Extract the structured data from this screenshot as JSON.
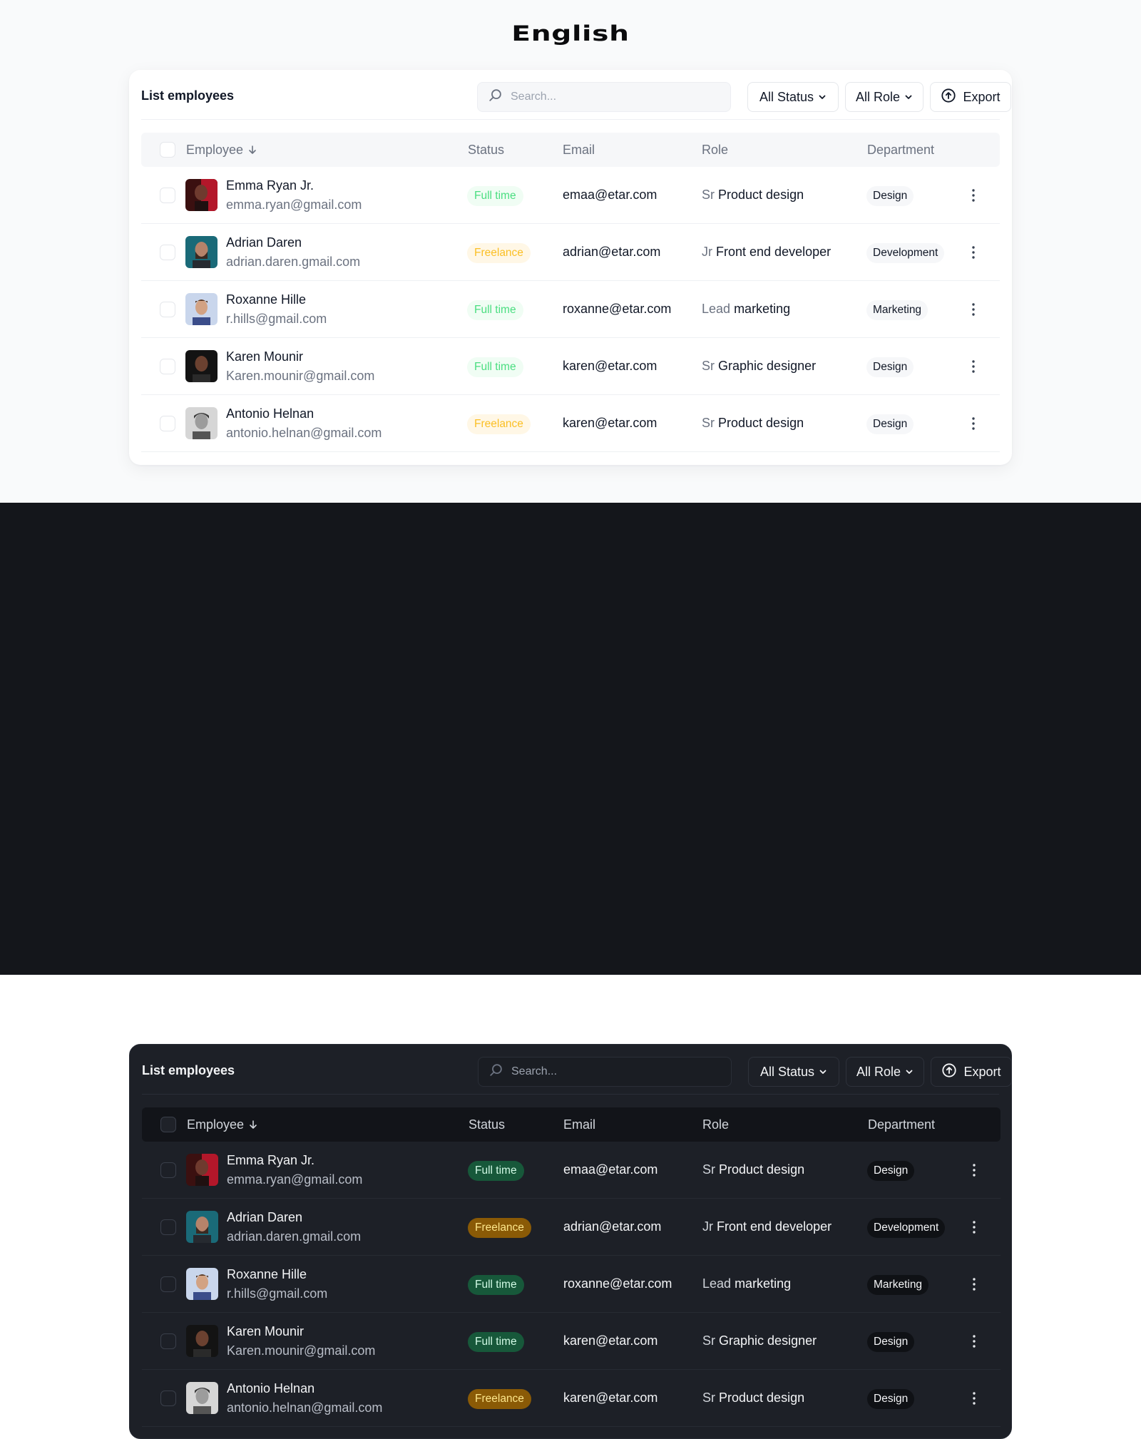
{
  "page": {
    "title": "English"
  },
  "card": {
    "title": "List employees",
    "search_placeholder": "Search...",
    "status_filter": "All Status",
    "role_filter": "All Role",
    "export_label": "Export"
  },
  "table": {
    "columns": {
      "employee": "Employee",
      "status": "Status",
      "email": "Email",
      "role": "Role",
      "department": "Department"
    },
    "rows": [
      {
        "name": "Emma Ryan Jr.",
        "personal_email": "emma.ryan@gmail.com",
        "status": "Full time",
        "status_type": "full",
        "email": "emaa@etar.com",
        "role_level": "Sr",
        "role_title": "Product design",
        "department": "Design",
        "avatar": "avatar-1"
      },
      {
        "name": "Adrian Daren",
        "personal_email": "adrian.daren.gmail.com",
        "status": "Freelance",
        "status_type": "free",
        "email": "adrian@etar.com",
        "role_level": "Jr",
        "role_title": "Front end developer",
        "department": "Development",
        "avatar": "avatar-2"
      },
      {
        "name": "Roxanne Hille",
        "personal_email": "r.hills@gmail.com",
        "status": "Full time",
        "status_type": "full",
        "email": "roxanne@etar.com",
        "role_level": "Lead",
        "role_title": "marketing",
        "department": "Marketing",
        "avatar": "avatar-3"
      },
      {
        "name": "Karen Mounir",
        "personal_email": "Karen.mounir@gmail.com",
        "status": "Full time",
        "status_type": "full",
        "email": "karen@etar.com",
        "role_level": "Sr",
        "role_title": "Graphic designer",
        "department": "Design",
        "avatar": "avatar-4"
      },
      {
        "name": "Antonio Helnan",
        "personal_email": "antonio.helnan@gmail.com",
        "status": "Freelance",
        "status_type": "free",
        "email": "karen@etar.com",
        "role_level": "Sr",
        "role_title": "Product design",
        "department": "Design",
        "avatar": "avatar-5"
      }
    ]
  },
  "icons": {
    "search": "search-icon",
    "chevron": "chevron-down-icon",
    "export": "upload-circle-icon",
    "sort": "arrow-down-icon",
    "more": "more-vertical-icon"
  },
  "colors": {
    "light_bg": "#f9fafb",
    "dark_bg": "#14161b",
    "full_time_light": "#4ade80",
    "freelance_light": "#fbbf24",
    "full_time_dark_bg": "#17583a",
    "freelance_dark_bg": "#8a5a06"
  }
}
